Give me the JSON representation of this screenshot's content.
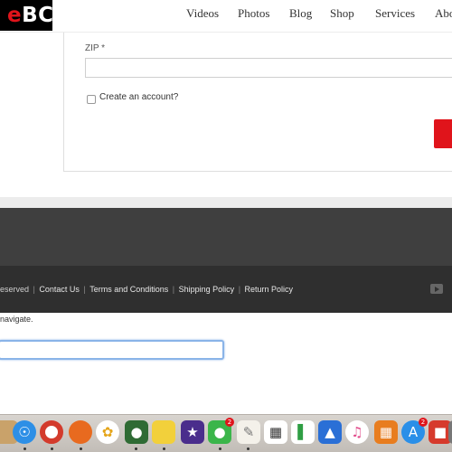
{
  "header": {
    "logo_prefix": "e",
    "logo_text": "BC",
    "nav": [
      "Videos",
      "Photos",
      "Blog",
      "Shop",
      "Services",
      "Abo"
    ]
  },
  "form": {
    "zip_label": "ZIP *",
    "zip_value": "",
    "create_account_label": "Create an account?"
  },
  "footer": {
    "reserved_text": "eserved",
    "links": [
      "Contact Us",
      "Terms and Conditions",
      "Shipping Policy",
      "Return Policy"
    ],
    "navigate_text": "navigate."
  },
  "dock": {
    "icons": [
      "app-icon",
      "safari-icon",
      "chrome-icon",
      "firefox-icon",
      "photos-icon",
      "evernote-icon",
      "stickies-icon",
      "imovie-icon",
      "facetime-icon",
      "textedit-icon",
      "calendar-icon",
      "numbers-icon",
      "keynote-icon",
      "itunes-icon",
      "ibooks-icon",
      "app-store-icon",
      "sketchup-icon",
      "preview-icon"
    ],
    "facetime_badge": "2",
    "app_store_badge": "2"
  }
}
